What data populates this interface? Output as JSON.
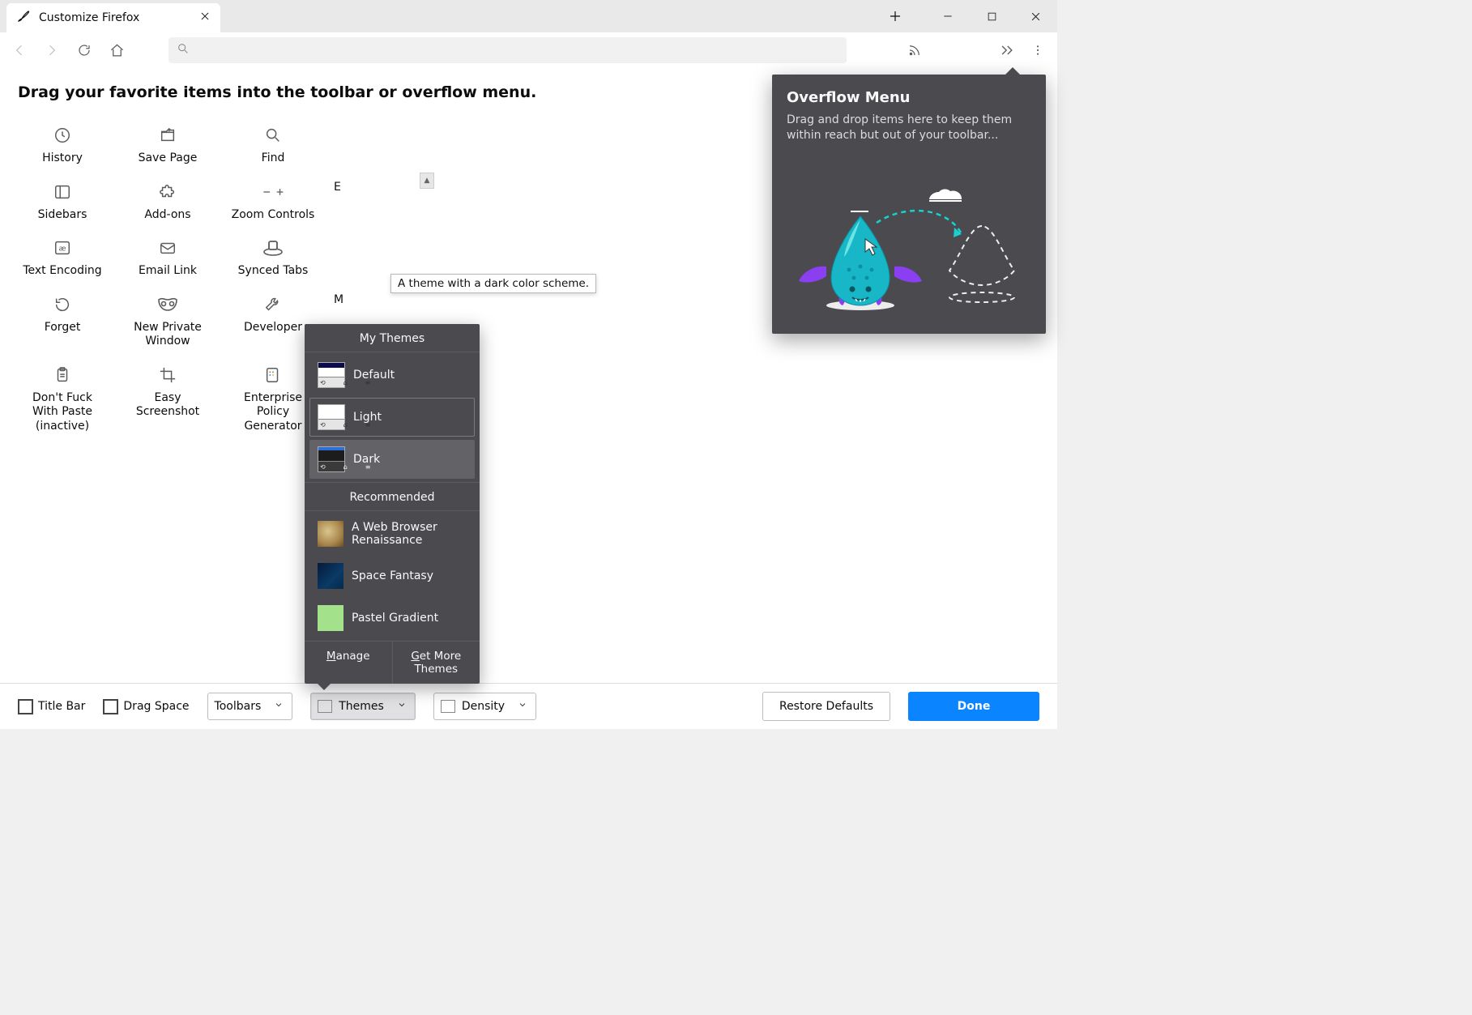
{
  "tab_title": "Customize Firefox",
  "headline": "Drag your favorite items into the toolbar or overflow menu.",
  "palette_items": [
    "History",
    "Save Page",
    "Find",
    "Sidebars",
    "Add-ons",
    "Zoom Controls",
    "Text Encoding",
    "Email Link",
    "Synced Tabs",
    "Forget",
    "New Private Window",
    "Developer",
    "Don't Fuck With Paste (inactive)",
    "Easy Screenshot",
    "Enterprise Policy Generator"
  ],
  "partial_items": [
    "E",
    "M"
  ],
  "themes_panel": {
    "section_my": "My Themes",
    "section_rec": "Recommended",
    "default": "Default",
    "light": "Light",
    "dark": "Dark",
    "rec_items": [
      "A Web Browser Renaissance",
      "Space Fantasy",
      "Pastel Gradient"
    ],
    "manage_label": "Manage",
    "manage_key": "M",
    "get_more_label": "Get More Themes",
    "get_more_key": "G"
  },
  "tooltip_text": "A theme with a dark color scheme.",
  "overflow": {
    "title": "Overflow Menu",
    "text": "Drag and drop items here to keep them within reach but out of your toolbar..."
  },
  "footer": {
    "title_bar": "Title Bar",
    "drag_space": "Drag Space",
    "toolbars": "Toolbars",
    "themes": "Themes",
    "density": "Density",
    "restore": "Restore Defaults",
    "done": "Done"
  }
}
